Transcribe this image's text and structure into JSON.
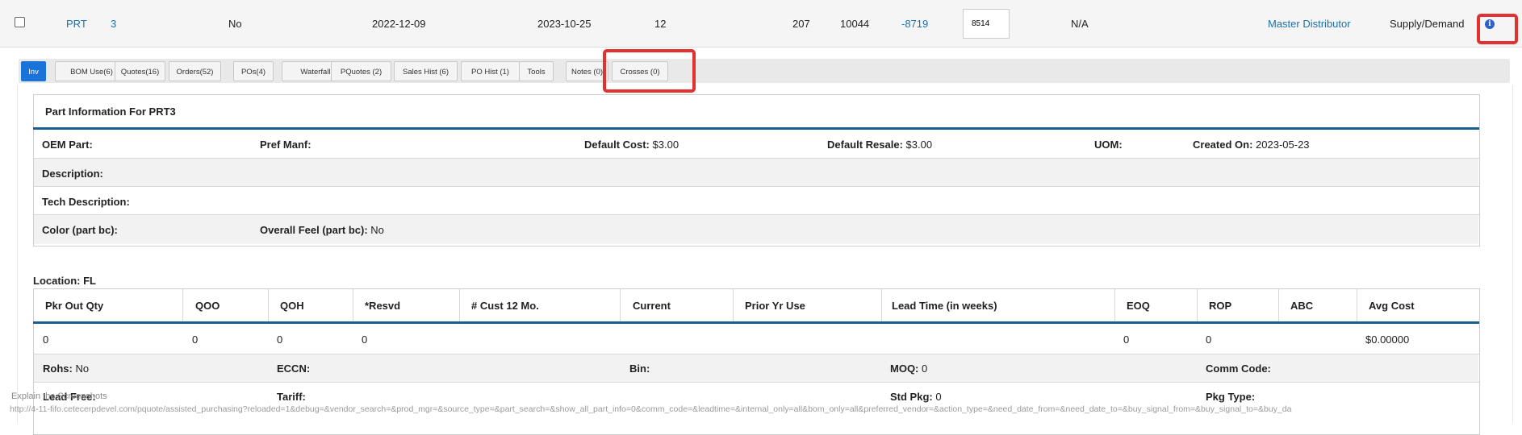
{
  "top_row": {
    "part_prefix": "PRT",
    "part_num": "3",
    "flag": "No",
    "date1": "2022-12-09",
    "date2": "2023-10-25",
    "num1": "12",
    "num2": "207",
    "num3": "10044",
    "neg_value": "-8719",
    "qty_input": "8514",
    "na": "N/A",
    "supplier": "Master Distributor",
    "category": "Supply/Demand",
    "info_icon": "info-icon"
  },
  "tabs": [
    {
      "label": "Inv",
      "active": true
    },
    {
      "label": "BOM Use(6)"
    },
    {
      "label": "Quotes(16)"
    },
    {
      "label": "Orders(52)"
    },
    {
      "label": "POs(4)"
    },
    {
      "label": "Waterfall"
    },
    {
      "label": "PQuotes (2)"
    },
    {
      "label": "Sales Hist (6)"
    },
    {
      "label": "PO Hist (1)"
    },
    {
      "label": "Tools"
    },
    {
      "label": "Notes (0)"
    },
    {
      "label": "Crosses (0)"
    }
  ],
  "part_info": {
    "title": "Part Information For PRT3",
    "oem_part_label": "OEM Part:",
    "pref_manf_label": "Pref Manf:",
    "default_cost_label": "Default Cost:",
    "default_cost_value": "$3.00",
    "default_resale_label": "Default Resale:",
    "default_resale_value": "$3.00",
    "uom_label": "UOM:",
    "created_on_label": "Created On:",
    "created_on_value": "2023-05-23",
    "description_label": "Description:",
    "tech_description_label": "Tech Description:",
    "color_label": "Color (part bc):",
    "overall_feel_label": "Overall Feel (part bc):",
    "overall_feel_value": "No"
  },
  "location": {
    "title": "Location: FL",
    "headers": [
      "Pkr Out Qty",
      "QOO",
      "QOH",
      "*Resvd",
      "# Cust 12 Mo.",
      "Current",
      "Prior Yr Use",
      "Lead Time (in weeks)",
      "EOQ",
      "ROP",
      "ABC",
      "Avg Cost"
    ],
    "row": [
      "0",
      "0",
      "0",
      "0",
      "",
      "",
      "",
      "",
      "0",
      "0",
      "",
      "$0.00000"
    ],
    "rohs_label": "Rohs:",
    "rohs_value": "No",
    "eccn_label": "ECCN:",
    "bin_label": "Bin:",
    "moq_label": "MOQ:",
    "moq_value": "0",
    "comm_code_label": "Comm Code:",
    "lead_free_label": "Lead Free:",
    "tariff_label": "Tariff:",
    "std_pkg_label": "Std Pkg:",
    "std_pkg_value": "0",
    "pkg_type_label": "Pkg Type:"
  },
  "footer": {
    "overlay_text": "Explain the Screenshots",
    "url": "http://4-11-fifo.cetecerpdevel.com/pquote/assisted_purchasing?reloaded=1&debug=&vendor_search=&prod_mgr=&source_type=&part_search=&show_all_part_info=0&comm_code=&leadtime=&internal_only=all&bom_only=all&preferred_vendor=&action_type=&need_date_from=&need_date_to=&buy_signal_from=&buy_signal_to=&buy_da"
  }
}
